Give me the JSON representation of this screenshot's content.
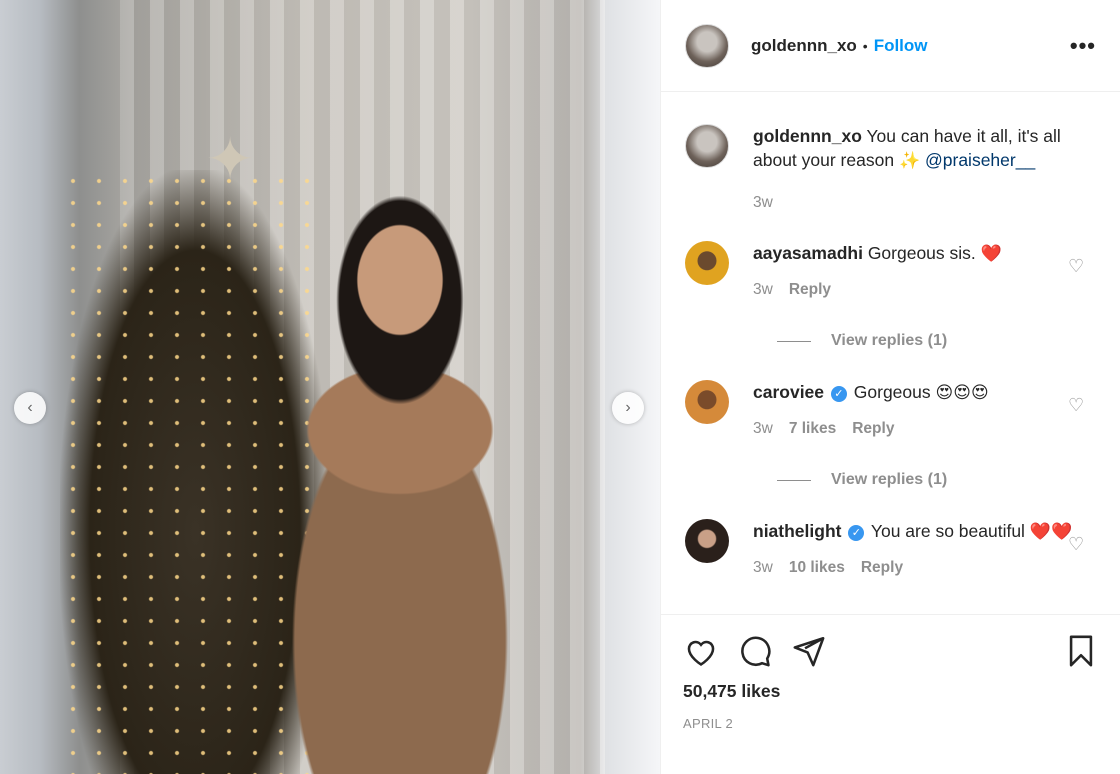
{
  "post": {
    "username": "goldennn_xo",
    "dot": "•",
    "follow_label": "Follow",
    "more_label": "•••",
    "likes": "50,475 likes",
    "date": "APRIL 2"
  },
  "photo": {
    "prev_label": "‹",
    "next_label": "›",
    "star_glyph": "✦"
  },
  "caption": {
    "username": "goldennn_xo",
    "text": "You can have it all, it's all about your reason",
    "sparkle": "✨",
    "mention": "@praiseher__",
    "time": "3w"
  },
  "comments": [
    {
      "username": "aayasamadhi",
      "verified": false,
      "text": "Gorgeous sis.",
      "emoji": "❤️",
      "time": "3w",
      "likes": "",
      "reply_label": "Reply",
      "view_replies": "View replies (1)",
      "avatar_color": "#e0a320"
    },
    {
      "username": "caroviee",
      "verified": true,
      "text": "Gorgeous",
      "emoji": "😍😍😍",
      "time": "3w",
      "likes": "7 likes",
      "reply_label": "Reply",
      "view_replies": "View replies (1)",
      "avatar_color": "#d58a3a"
    },
    {
      "username": "niathelight",
      "verified": true,
      "text": "You are so beautiful",
      "emoji": "❤️❤️",
      "time": "3w",
      "likes": "10 likes",
      "reply_label": "Reply",
      "avatar_color": "#3a2d26"
    }
  ],
  "icons": {
    "like": "heart-icon",
    "comment": "comment-icon",
    "share": "share-icon",
    "save": "bookmark-icon",
    "small_heart": "♡"
  },
  "colors": {
    "accent": "#0095f6",
    "mention": "#00376b",
    "muted": "#8e8e8e",
    "verified": "#3897f0"
  }
}
